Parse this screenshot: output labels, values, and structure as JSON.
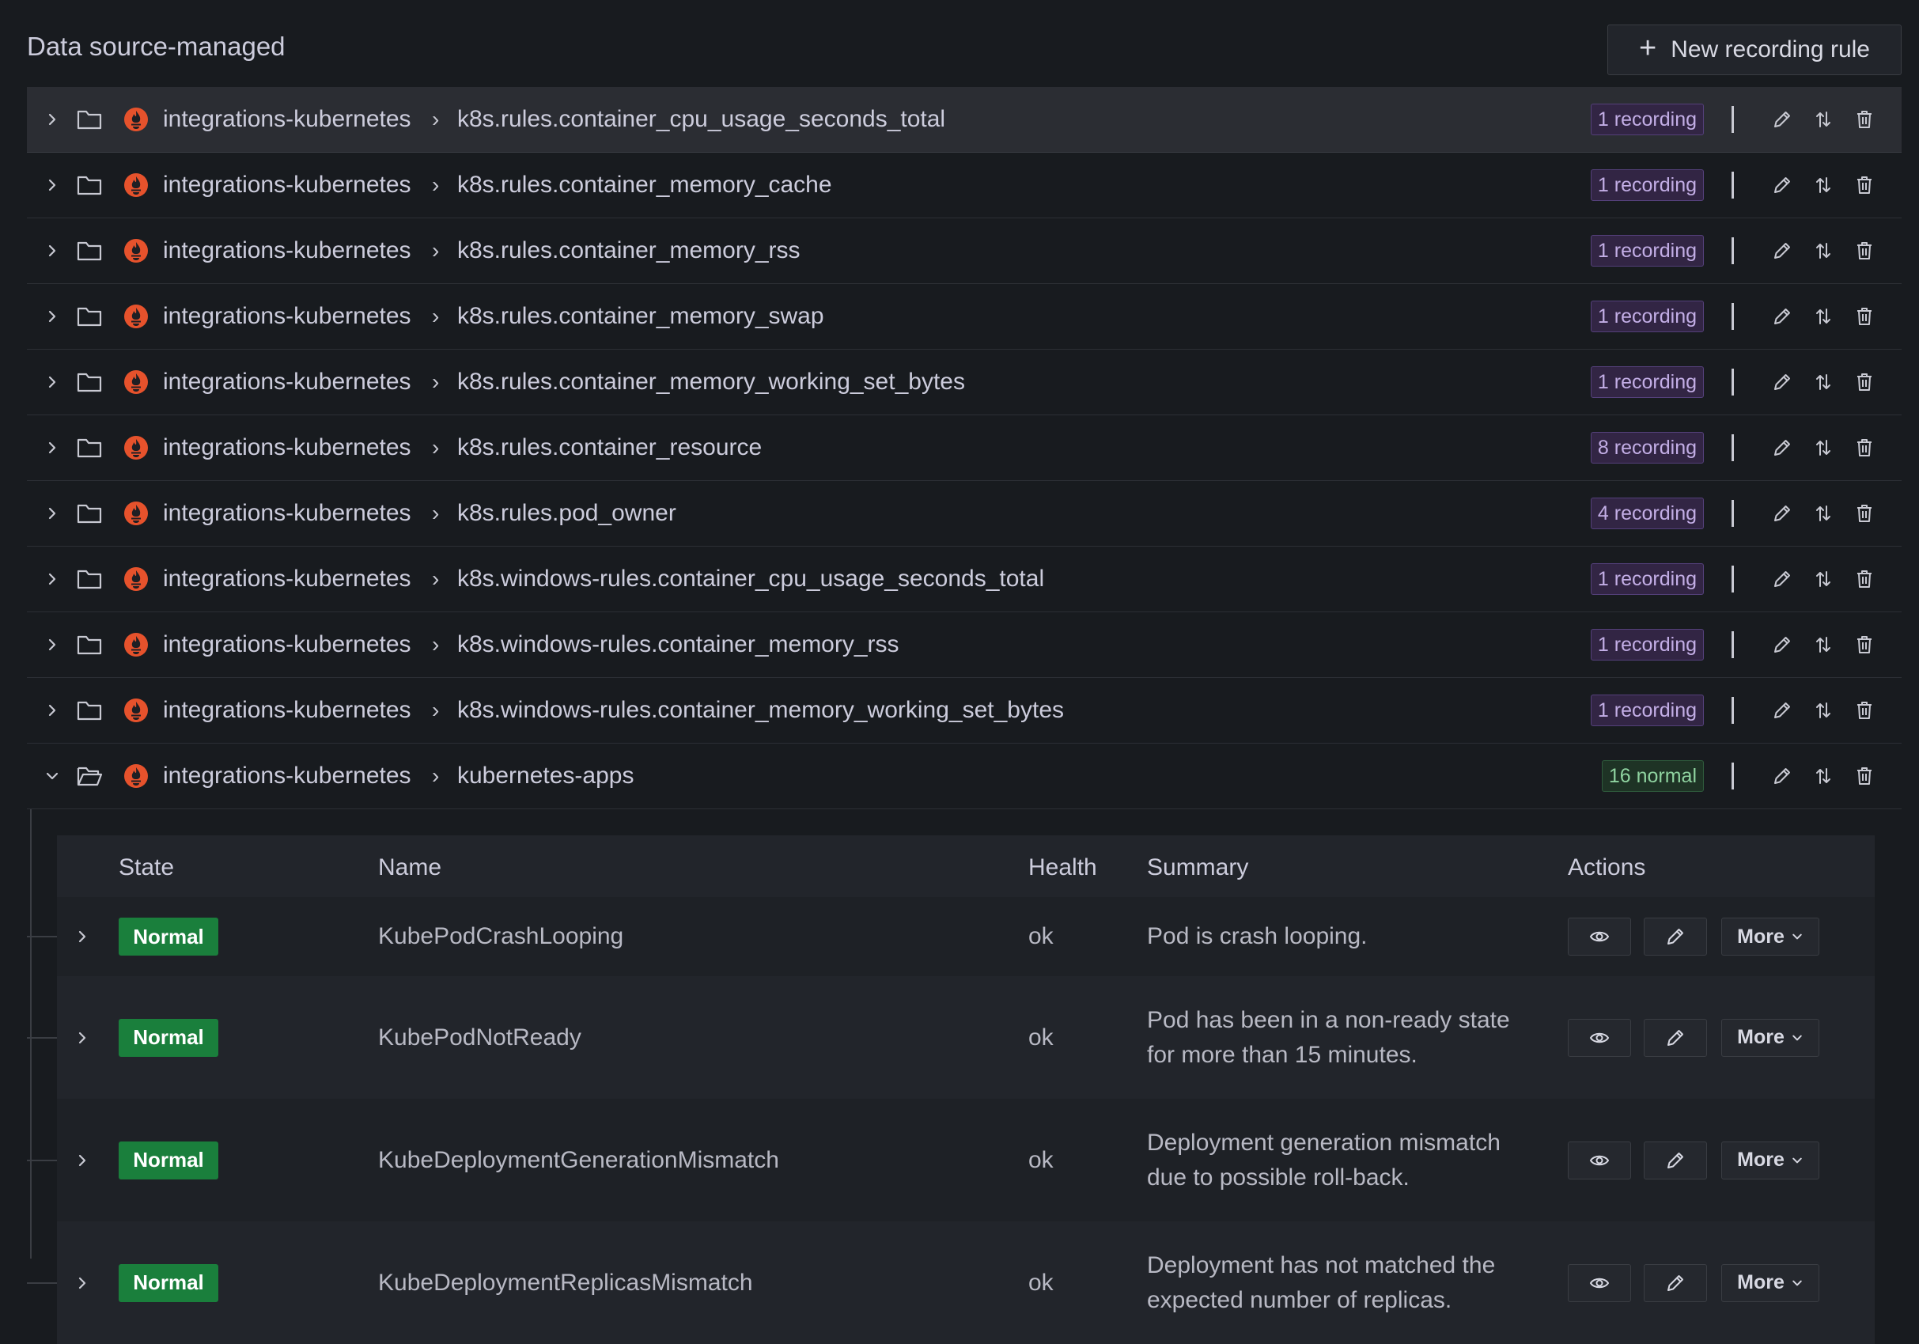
{
  "header": {
    "title": "Data source-managed",
    "new_button_label": "New recording rule",
    "new_button_icon": "plus-icon"
  },
  "groups": [
    {
      "namespace": "integrations-kubernetes",
      "name": "k8s.rules.container_cpu_usage_seconds_total",
      "badge": "1 recording",
      "badge_type": "recording",
      "expanded": false,
      "highlighted": true
    },
    {
      "namespace": "integrations-kubernetes",
      "name": "k8s.rules.container_memory_cache",
      "badge": "1 recording",
      "badge_type": "recording",
      "expanded": false
    },
    {
      "namespace": "integrations-kubernetes",
      "name": "k8s.rules.container_memory_rss",
      "badge": "1 recording",
      "badge_type": "recording",
      "expanded": false
    },
    {
      "namespace": "integrations-kubernetes",
      "name": "k8s.rules.container_memory_swap",
      "badge": "1 recording",
      "badge_type": "recording",
      "expanded": false
    },
    {
      "namespace": "integrations-kubernetes",
      "name": "k8s.rules.container_memory_working_set_bytes",
      "badge": "1 recording",
      "badge_type": "recording",
      "expanded": false
    },
    {
      "namespace": "integrations-kubernetes",
      "name": "k8s.rules.container_resource",
      "badge": "8 recording",
      "badge_type": "recording",
      "expanded": false
    },
    {
      "namespace": "integrations-kubernetes",
      "name": "k8s.rules.pod_owner",
      "badge": "4 recording",
      "badge_type": "recording",
      "expanded": false
    },
    {
      "namespace": "integrations-kubernetes",
      "name": "k8s.windows-rules.container_cpu_usage_seconds_total",
      "badge": "1 recording",
      "badge_type": "recording",
      "expanded": false
    },
    {
      "namespace": "integrations-kubernetes",
      "name": "k8s.windows-rules.container_memory_rss",
      "badge": "1 recording",
      "badge_type": "recording",
      "expanded": false
    },
    {
      "namespace": "integrations-kubernetes",
      "name": "k8s.windows-rules.container_memory_working_set_bytes",
      "badge": "1 recording",
      "badge_type": "recording",
      "expanded": false
    },
    {
      "namespace": "integrations-kubernetes",
      "name": "kubernetes-apps",
      "badge": "16 normal",
      "badge_type": "normal",
      "expanded": true
    }
  ],
  "breadcrumb_separator": "›",
  "rules_table": {
    "columns": [
      "State",
      "Name",
      "Health",
      "Summary",
      "Actions"
    ],
    "rows": [
      {
        "state": "Normal",
        "name": "KubePodCrashLooping",
        "health": "ok",
        "summary": "Pod is crash looping."
      },
      {
        "state": "Normal",
        "name": "KubePodNotReady",
        "health": "ok",
        "summary": "Pod has been in a non-ready state for more than 15 minutes."
      },
      {
        "state": "Normal",
        "name": "KubeDeploymentGenerationMismatch",
        "health": "ok",
        "summary": "Deployment generation mismatch due to possible roll-back."
      },
      {
        "state": "Normal",
        "name": "KubeDeploymentReplicasMismatch",
        "health": "ok",
        "summary": "Deployment has not matched the expected number of replicas."
      }
    ],
    "more_label": "More"
  },
  "colors": {
    "background": "#181b1f",
    "recording_badge": "#c3aee6",
    "normal_badge": "#8fd3a0",
    "state_normal": "#1a7f3c",
    "prometheus_logo": "#e6522c"
  },
  "icons": {
    "expand": "chevron-right-icon",
    "collapse": "chevron-down-icon",
    "folder": "folder-icon",
    "folder_open": "folder-open-icon",
    "datasource": "prometheus-logo-icon",
    "edit": "pencil-icon",
    "reorder": "arrows-up-down-icon",
    "delete": "trash-icon",
    "view": "eye-icon"
  }
}
